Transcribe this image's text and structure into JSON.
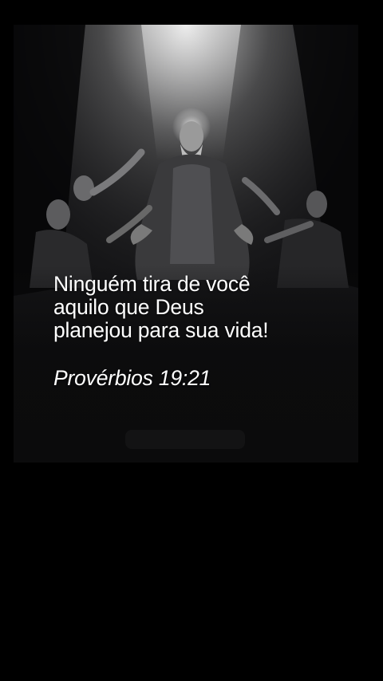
{
  "post": {
    "quote_text": "Ninguém tira de você\naquilo que Deus\nplanejou para sua vida!",
    "reference": "Provérbios 19:21"
  },
  "artwork": {
    "scene": "monochrome-painting-robed-figure-with-halo-under-light-beam-surrounded-by-reaching-hands"
  },
  "colors": {
    "background": "#000000",
    "card": "#0b0b0c",
    "text": "#ffffff"
  }
}
